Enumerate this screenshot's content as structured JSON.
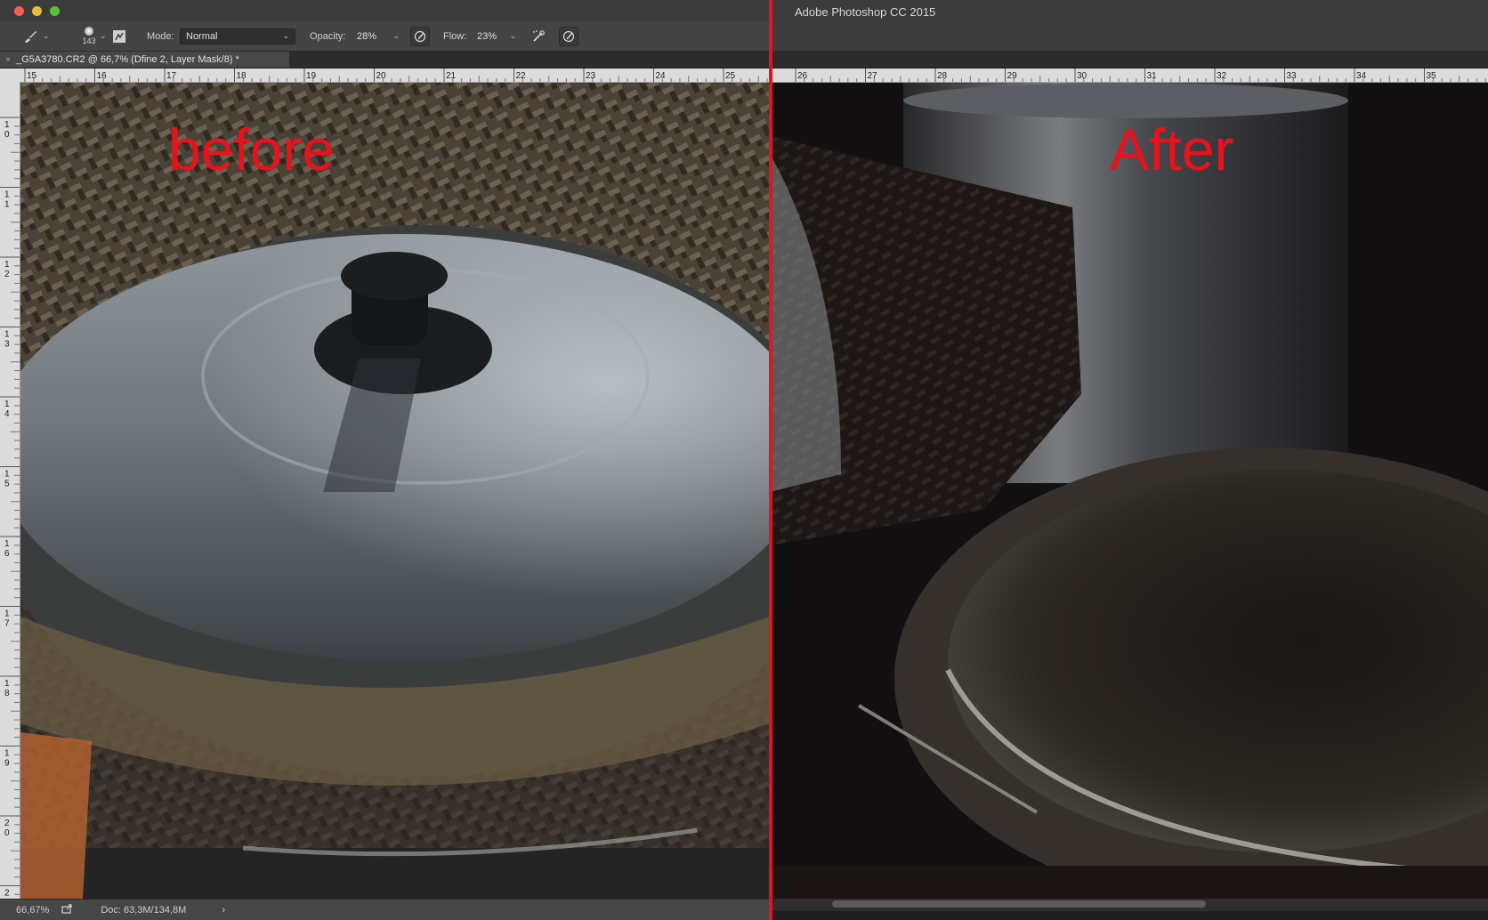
{
  "left_window": {
    "title_bar": {
      "traffic_lights": [
        "close",
        "minimize",
        "zoom"
      ]
    },
    "options_bar": {
      "tool_icon": "brush-icon",
      "brush_size": "143",
      "mode_label": "Mode:",
      "mode_value": "Normal",
      "opacity_label": "Opacity:",
      "opacity_value": "28%",
      "flow_label": "Flow:",
      "flow_value": "23%"
    },
    "document_tab": {
      "close_glyph": "×",
      "title": "_G5A3780.CR2 @ 66,7% (Dfine 2, Layer Mask/8) *"
    },
    "ruler_labels": [
      "15",
      "16",
      "17",
      "18",
      "19",
      "20",
      "21",
      "22",
      "23",
      "24",
      "25"
    ],
    "vertical_ruler_labels": [
      "1 0",
      "1 1",
      "1 2",
      "1 3",
      "1 4",
      "1 5",
      "1 6",
      "1 7",
      "1 8",
      "1 9",
      "2 0",
      "2"
    ],
    "overlay_label": "before",
    "status_bar": {
      "zoom": "66,67%",
      "doc_info": "Doc: 63,3M/134,8M",
      "arrow": "›"
    }
  },
  "right_window": {
    "title": "Adobe Photoshop CC 2015",
    "ruler_labels": [
      "26",
      "27",
      "28",
      "29",
      "30",
      "31",
      "32",
      "33",
      "34",
      "35"
    ],
    "overlay_label": "After"
  },
  "colors": {
    "accent_red": "#e8111c",
    "panel_bg": "#434343",
    "ruler_bg": "#dcdcdc"
  }
}
